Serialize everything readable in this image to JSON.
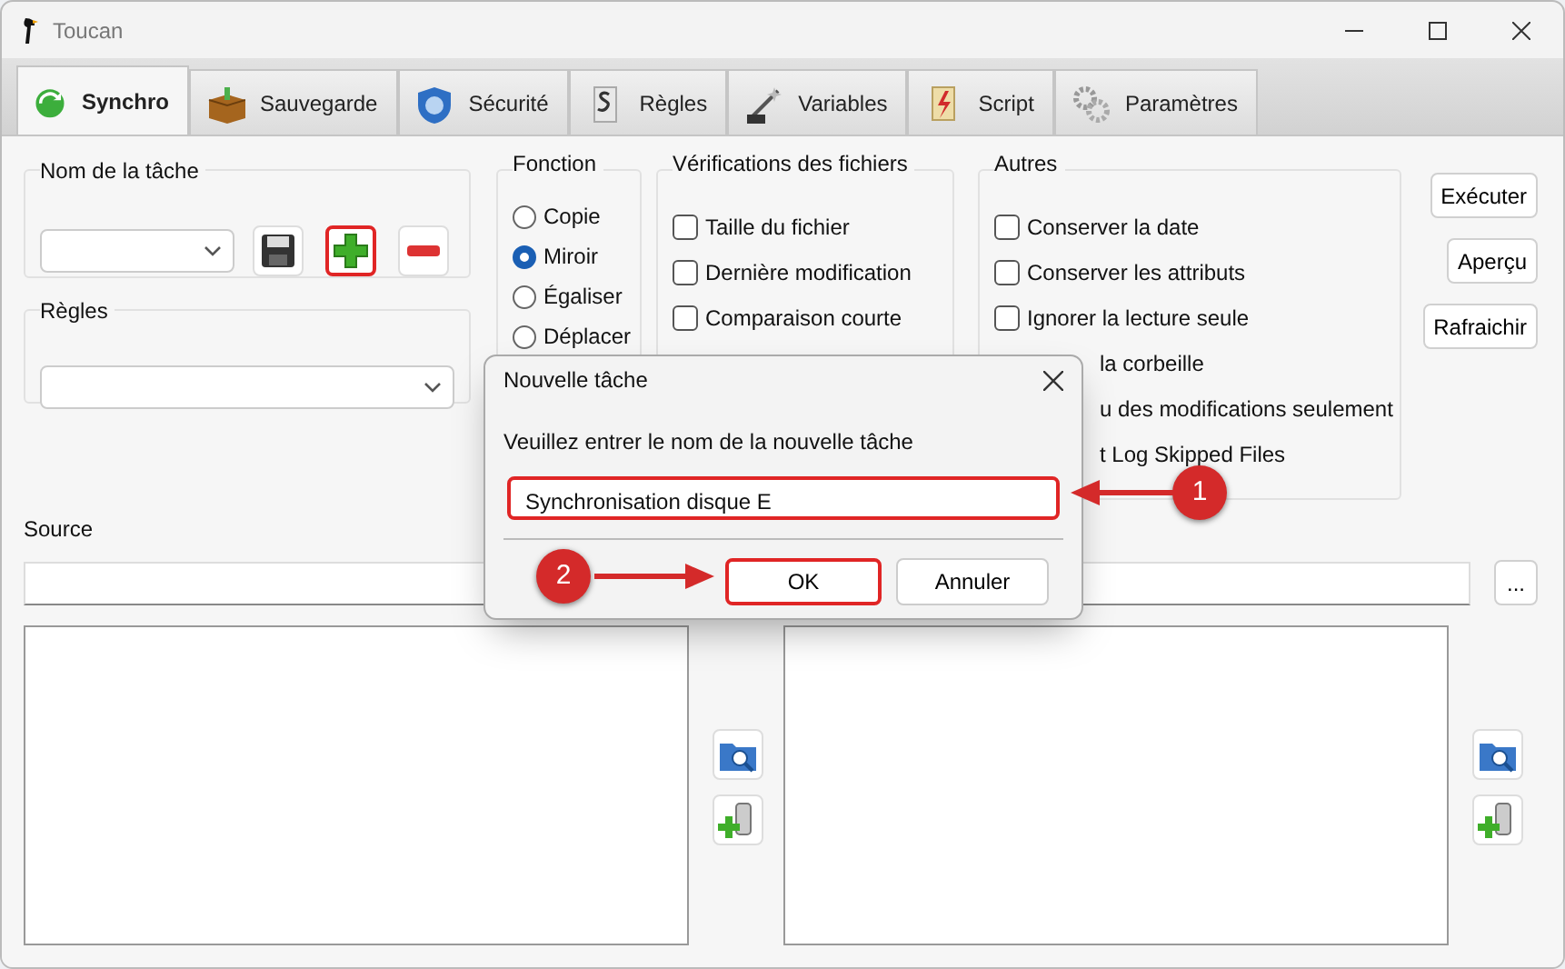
{
  "window": {
    "title": "Toucan"
  },
  "tabs": [
    {
      "label": "Synchro",
      "selected": true,
      "kind": "sync"
    },
    {
      "label": "Sauvegarde",
      "selected": false,
      "kind": "box"
    },
    {
      "label": "Sécurité",
      "selected": false,
      "kind": "shield"
    },
    {
      "label": "Règles",
      "selected": false,
      "kind": "law"
    },
    {
      "label": "Variables",
      "selected": false,
      "kind": "var"
    },
    {
      "label": "Script",
      "selected": false,
      "kind": "script"
    },
    {
      "label": "Paramètres",
      "selected": false,
      "kind": "gears"
    }
  ],
  "task_group": {
    "title": "Nom de la tâche",
    "add_highlighted": true
  },
  "rules_group": {
    "title": "Règles"
  },
  "function_group": {
    "title": "Fonction",
    "options": [
      {
        "label": "Copie",
        "selected": false
      },
      {
        "label": "Miroir",
        "selected": true
      },
      {
        "label": "Égaliser",
        "selected": false
      },
      {
        "label": "Déplacer",
        "selected": false
      }
    ]
  },
  "checks_group": {
    "title": "Vérifications des fichiers",
    "options": [
      {
        "label": "Taille du fichier",
        "checked": false
      },
      {
        "label": "Dernière modification",
        "checked": false
      },
      {
        "label": "Comparaison courte",
        "checked": false
      }
    ]
  },
  "other_group": {
    "title": "Autres",
    "options": [
      {
        "label": "Conserver la date",
        "checked": false,
        "covered": false
      },
      {
        "label": "Conserver les attributs",
        "checked": false,
        "covered": false
      },
      {
        "label": "Ignorer la lecture seule",
        "checked": false,
        "covered": false
      },
      {
        "label": "la corbeille",
        "covered": true
      },
      {
        "label": "u des modifications seulement",
        "covered": true
      },
      {
        "label": "t Log Skipped Files",
        "covered": true
      }
    ]
  },
  "actions": [
    "Exécuter",
    "Aperçu",
    "Rafraichir"
  ],
  "source": {
    "label": "Source"
  },
  "browse_button": "...",
  "dialog": {
    "title": "Nouvelle tâche",
    "prompt": "Veuillez entrer le nom de la nouvelle tâche",
    "value": "Synchronisation disque E",
    "input_highlighted": true,
    "buttons": [
      {
        "label": "OK",
        "highlighted": true
      },
      {
        "label": "Annuler",
        "highlighted": false
      }
    ]
  },
  "callouts": [
    {
      "number": "1"
    },
    {
      "number": "2"
    }
  ]
}
